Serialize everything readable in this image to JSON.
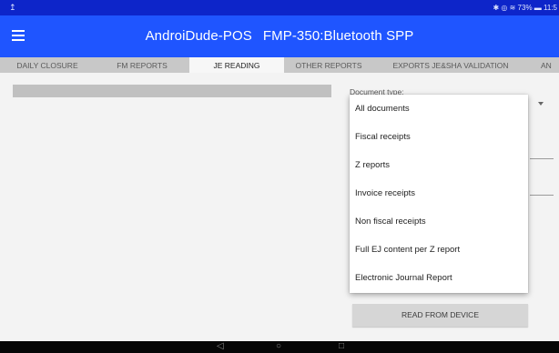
{
  "status_bar": {
    "left_icon": "↥",
    "right_text": "✱ ◎ ≋ 73% ▬ 11:5",
    "battery_level_percent": 73,
    "icons": [
      "upload-icon",
      "bluetooth-icon",
      "vibrate-icon",
      "wifi-icon",
      "battery-icon"
    ]
  },
  "app_bar": {
    "app_name": "AndroiDude-POS",
    "device": "FMP-350:Bluetooth SPP",
    "background_color": "#1f55ff"
  },
  "tabs": [
    {
      "label": "DAILY CLOSURE"
    },
    {
      "label": "FM REPORTS"
    },
    {
      "label": "JE READING"
    },
    {
      "label": "OTHER REPORTS"
    },
    {
      "label": "EXPORTS JE&SHA VALIDATION"
    },
    {
      "label": "AN"
    }
  ],
  "active_tab": "JE READING",
  "document_type": {
    "label": "Document type:",
    "options": [
      "All documents",
      "Fiscal receipts",
      "Z reports",
      "Invoice receipts",
      "Non fiscal receipts",
      "Full EJ content per Z report",
      "Electronic Journal Report"
    ]
  },
  "read_button_label": "READ FROM DEVICE",
  "nav_bar": {
    "back": "◁",
    "home": "○",
    "recents": "□"
  }
}
